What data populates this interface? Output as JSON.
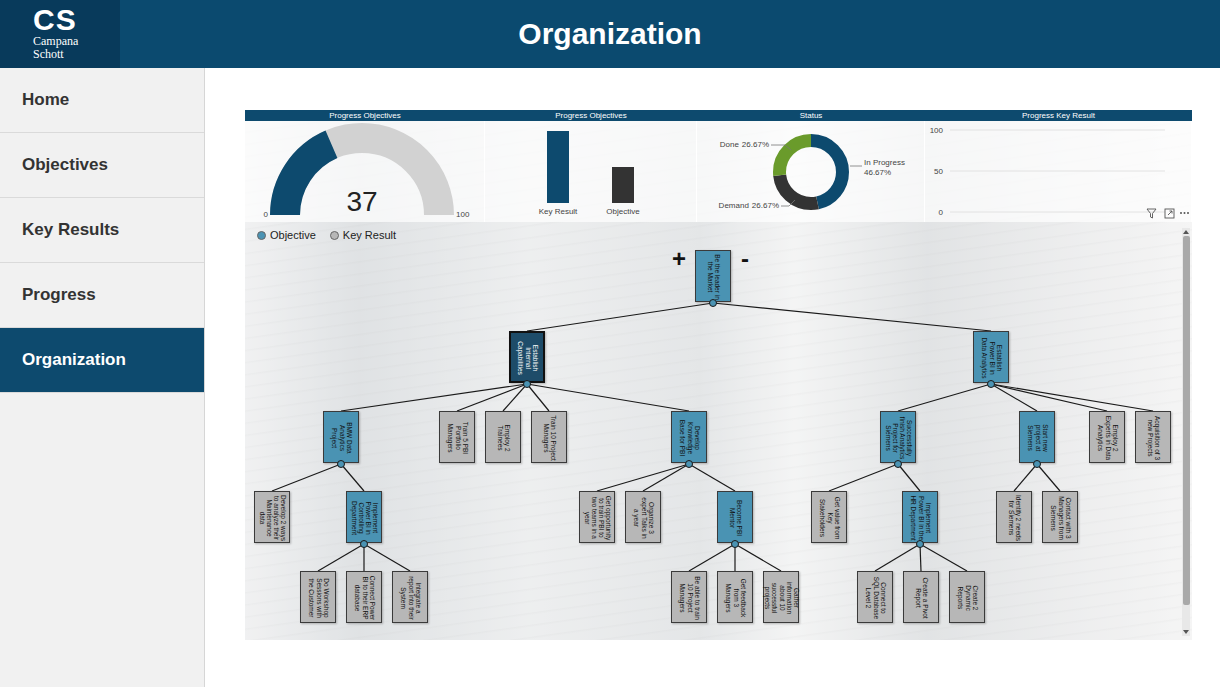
{
  "logo": {
    "mark": "CS",
    "line1": "Campana",
    "line2": "Schott"
  },
  "header": {
    "title": "Organization"
  },
  "sidebar": {
    "items": [
      {
        "label": "Home",
        "selected": false
      },
      {
        "label": "Objectives",
        "selected": false
      },
      {
        "label": "Key Results",
        "selected": false
      },
      {
        "label": "Progress",
        "selected": false
      },
      {
        "label": "Organization",
        "selected": true
      }
    ]
  },
  "cards": {
    "gauge": {
      "title": "Progress Objectives",
      "value": "37",
      "min": "0",
      "max": "100",
      "level": 0.37
    },
    "bars": {
      "title": "Progress Objectives",
      "series": [
        {
          "label": "Key Result",
          "value": 74,
          "color": "#0d4a6e"
        },
        {
          "label": "Objective",
          "value": 37,
          "color": "#333333"
        }
      ]
    },
    "status": {
      "title": "Status",
      "segments": [
        {
          "label": "In Progress",
          "reading": "46.67%",
          "share": 0.4667,
          "color": "#0d4a6e"
        },
        {
          "label": "Demand",
          "reading": "26.67%",
          "share": 0.2667,
          "color": "#333333"
        },
        {
          "label": "Done",
          "reading": "26.67%",
          "share": 0.2667,
          "color": "#6a9b2b"
        }
      ]
    },
    "keyResult": {
      "title": "Progress Key Result",
      "ticks": [
        "100",
        "50",
        "0"
      ]
    }
  },
  "tree": {
    "legend": [
      {
        "label": "Objective",
        "kind": "objective",
        "color": "#4a93b3"
      },
      {
        "label": "Key Result",
        "kind": "key-result",
        "color": "#b7b7b7"
      }
    ],
    "zoom": {
      "in": "+",
      "out": "-"
    },
    "scrollbar": {
      "level": 0.95
    },
    "root": {
      "text": "Be the leader in the Market",
      "kind": "objective",
      "selected": false,
      "children": [
        {
          "text": "Establish Internal Capabilities",
          "kind": "objective",
          "selected": true,
          "children": [
            {
              "text": "BMW Data Analytics Project",
              "kind": "objective",
              "selected": false,
              "children": [
                {
                  "text": "Develop 2 ways to analyze their Maintenance data",
                  "kind": "key-result",
                  "selected": false,
                  "children": []
                },
                {
                  "text": "Implement Power BI in Controlling Department",
                  "kind": "objective",
                  "selected": false,
                  "children": [
                    {
                      "text": "Do Workshop Sessions with the Customer",
                      "kind": "key-result",
                      "selected": false,
                      "children": []
                    },
                    {
                      "text": "Connect Power BI to their ERP database",
                      "kind": "key-result",
                      "selected": false,
                      "children": []
                    },
                    {
                      "text": "Integrate a report into their System",
                      "kind": "key-result",
                      "selected": false,
                      "children": []
                    }
                  ]
                }
              ]
            },
            {
              "text": "Train 5 PBI Portfolio Managers",
              "kind": "key-result",
              "selected": false,
              "children": []
            },
            {
              "text": "Employ 2 Trainees",
              "kind": "key-result",
              "selected": false,
              "children": []
            },
            {
              "text": "Train 10 Project Managers",
              "kind": "key-result",
              "selected": false,
              "children": []
            },
            {
              "text": "Develop Knowledge Base for PBI",
              "kind": "objective",
              "selected": false,
              "children": [
                {
                  "text": "Get opportunity to train PBI to two teams in a year",
                  "kind": "key-result",
                  "selected": false,
                  "children": []
                },
                {
                  "text": "Organize 3 expert Talks in a year",
                  "kind": "key-result",
                  "selected": false,
                  "children": []
                },
                {
                  "text": "Become PBI Mentor",
                  "kind": "objective",
                  "selected": false,
                  "children": [
                    {
                      "text": "Be able to train 10 Project Managers",
                      "kind": "key-result",
                      "selected": false,
                      "children": []
                    },
                    {
                      "text": "Get feedback from 3 Managers",
                      "kind": "key-result",
                      "selected": false,
                      "children": []
                    },
                    {
                      "text": "Gather information about 10 successful projects",
                      "kind": "key-result",
                      "selected": false,
                      "children": []
                    }
                  ]
                }
              ]
            }
          ]
        },
        {
          "text": "Establish Power BI in Data Analytics",
          "kind": "objective",
          "selected": false,
          "children": [
            {
              "text": "Successfully finish Analytics Project for Siemens",
              "kind": "objective",
              "selected": false,
              "children": [
                {
                  "text": "Get value from Key Stakeholders",
                  "kind": "key-result",
                  "selected": false,
                  "children": []
                },
                {
                  "text": "Implement Power BI in the HR Department",
                  "kind": "objective",
                  "selected": false,
                  "children": [
                    {
                      "text": "Connect to SQL Database Level 2",
                      "kind": "key-result",
                      "selected": false,
                      "children": []
                    },
                    {
                      "text": "Create a Pivot Report",
                      "kind": "key-result",
                      "selected": false,
                      "children": []
                    },
                    {
                      "text": "Create 2 Dynamic Reports",
                      "kind": "key-result",
                      "selected": false,
                      "children": []
                    }
                  ]
                }
              ]
            },
            {
              "text": "Start new project at Siemens",
              "kind": "objective",
              "selected": false,
              "children": [
                {
                  "text": "Identify 2 needs for Siemens",
                  "kind": "key-result",
                  "selected": false,
                  "children": []
                },
                {
                  "text": "Contact with 3 Managers from Siemens",
                  "kind": "key-result",
                  "selected": false,
                  "children": []
                }
              ]
            },
            {
              "text": "Employ 2 Experts in Data Analytics",
              "kind": "key-result",
              "selected": false,
              "children": []
            },
            {
              "text": "Acquisition of 3 new Projects",
              "kind": "key-result",
              "selected": false,
              "children": []
            }
          ]
        }
      ]
    }
  }
}
